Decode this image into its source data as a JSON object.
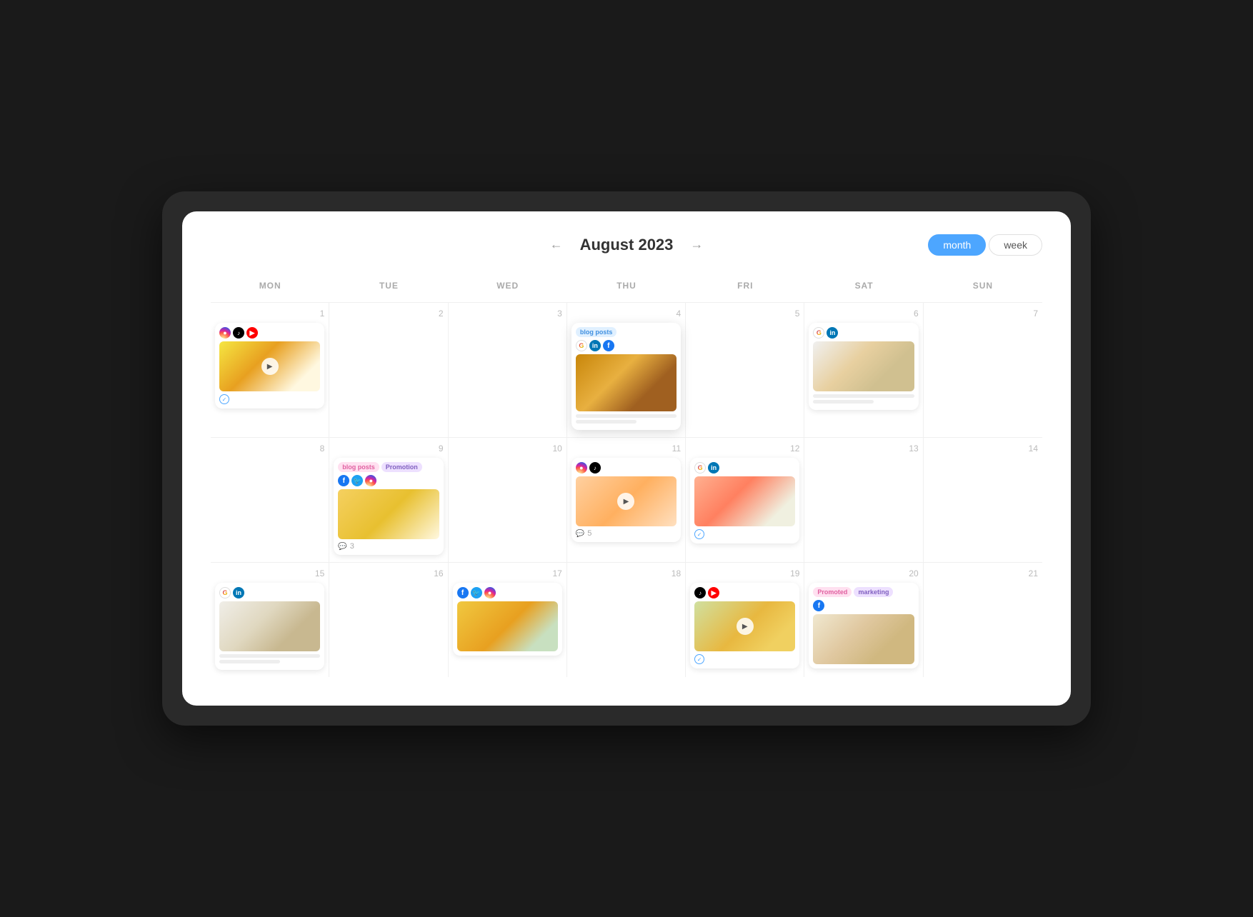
{
  "header": {
    "month_title": "August 2023",
    "prev_arrow": "←",
    "next_arrow": "→",
    "view_month": "month",
    "view_week": "week"
  },
  "day_headers": [
    "MON",
    "TUE",
    "WED",
    "THU",
    "FRI",
    "SAT",
    "SUN"
  ],
  "weeks": [
    {
      "days": [
        {
          "date": "1",
          "has_post": true,
          "post_type": "image_play",
          "social": [
            "instagram",
            "tiktok",
            "youtube"
          ],
          "image_class": "img-pineapple",
          "footer": "check",
          "tags": []
        },
        {
          "date": "2",
          "has_post": false
        },
        {
          "date": "3",
          "has_post": false
        },
        {
          "date": "4",
          "has_post": true,
          "post_type": "image",
          "social": [
            "google",
            "linkedin",
            "facebook"
          ],
          "image_class": "img-citrus-board",
          "footer": "lines",
          "tags": [
            "blog_posts"
          ],
          "tag_style": "tag-blue",
          "featured": true
        },
        {
          "date": "5",
          "has_post": false
        },
        {
          "date": "6",
          "has_post": true,
          "post_type": "image",
          "social": [
            "google",
            "linkedin"
          ],
          "image_class": "img-candles",
          "footer": "lines"
        },
        {
          "date": "7",
          "has_post": false
        }
      ]
    },
    {
      "days": [
        {
          "date": "8",
          "has_post": false
        },
        {
          "date": "9",
          "has_post": true,
          "post_type": "image",
          "social": [
            "facebook",
            "twitter",
            "instagram"
          ],
          "image_class": "img-smoothie",
          "footer": "comment",
          "comment_count": "3",
          "tags": [
            "blog_posts",
            "promotion"
          ],
          "tag_style1": "tag-pink",
          "tag_style2": "tag-purple"
        },
        {
          "date": "10",
          "has_post": false
        },
        {
          "date": "11",
          "has_post": true,
          "post_type": "image_play",
          "social": [
            "instagram",
            "tiktok"
          ],
          "image_class": "img-mango-slices",
          "footer": "comment",
          "comment_count": "5"
        },
        {
          "date": "12",
          "has_post": true,
          "post_type": "image",
          "social": [
            "google",
            "linkedin"
          ],
          "image_class": "img-grapefruit",
          "footer": "check"
        },
        {
          "date": "13",
          "has_post": false
        },
        {
          "date": "14",
          "has_post": false
        }
      ]
    },
    {
      "days": [
        {
          "date": "15",
          "has_post": true,
          "post_type": "image",
          "social": [
            "google",
            "linkedin"
          ],
          "image_class": "img-candles2",
          "footer": "lines"
        },
        {
          "date": "16",
          "has_post": false
        },
        {
          "date": "17",
          "has_post": true,
          "post_type": "image",
          "social": [
            "facebook",
            "twitter",
            "instagram"
          ],
          "image_class": "img-oranges",
          "footer": "none"
        },
        {
          "date": "18",
          "has_post": false
        },
        {
          "date": "19",
          "has_post": true,
          "post_type": "image_play",
          "social": [
            "tiktok",
            "youtube"
          ],
          "image_class": "img-orange-leaves",
          "footer": "check"
        },
        {
          "date": "20",
          "has_post": true,
          "post_type": "image",
          "social": [
            "facebook"
          ],
          "image_class": "img-mixed",
          "footer": "none",
          "tags": [
            "promoted",
            "marketing"
          ],
          "tag_style1": "tag-pink",
          "tag_style2": "tag-purple"
        },
        {
          "date": "21",
          "has_post": false
        }
      ]
    }
  ],
  "colors": {
    "accent": "#4da6ff",
    "month_btn_active": "#4da6ff",
    "week_btn": "#fff"
  }
}
